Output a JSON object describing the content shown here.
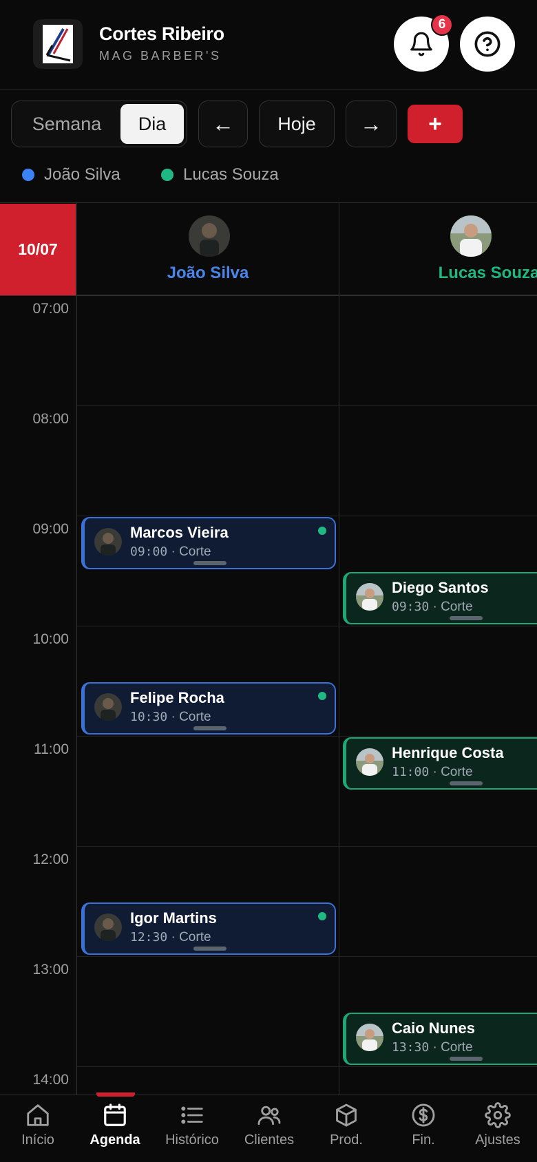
{
  "header": {
    "brand_name": "Cortes Ribeiro",
    "brand_sub": "MAG BARBER'S",
    "notification_count": "6"
  },
  "toolbar": {
    "week_label": "Semana",
    "day_label": "Dia",
    "prev_label": "←",
    "today_label": "Hoje",
    "next_label": "→",
    "add_label": "+"
  },
  "legend": [
    {
      "name": "João Silva",
      "color": "#3b82f6"
    },
    {
      "name": "Lucas Souza",
      "color": "#1fb882"
    }
  ],
  "calendar": {
    "date": "10/07",
    "columns": [
      {
        "name": "João Silva",
        "color": "#4a85ea"
      },
      {
        "name": "Lucas Souza",
        "color": "#1fb882"
      }
    ],
    "times": [
      "07:00",
      "08:00",
      "09:00",
      "10:00",
      "11:00",
      "12:00",
      "13:00",
      "14:00"
    ],
    "appointments": [
      {
        "client": "Marcos Vieira",
        "time": "09:00",
        "service": "· Corte",
        "barber": "João Silva"
      },
      {
        "client": "Diego Santos",
        "time": "09:30",
        "service": "· Corte",
        "barber": "Lucas Souza"
      },
      {
        "client": "Felipe Rocha",
        "time": "10:30",
        "service": "· Corte",
        "barber": "João Silva"
      },
      {
        "client": "Henrique Costa",
        "time": "11:00",
        "service": "· Corte",
        "barber": "Lucas Souza"
      },
      {
        "client": "Igor Martins",
        "time": "12:30",
        "service": "· Corte",
        "barber": "João Silva"
      },
      {
        "client": "Caio Nunes",
        "time": "13:30",
        "service": "· Corte",
        "barber": "Lucas Souza"
      }
    ]
  },
  "nav": [
    {
      "label": "Início",
      "icon": "home-icon",
      "active": false
    },
    {
      "label": "Agenda",
      "icon": "calendar-icon",
      "active": true
    },
    {
      "label": "Histórico",
      "icon": "list-icon",
      "active": false
    },
    {
      "label": "Clientes",
      "icon": "users-icon",
      "active": false
    },
    {
      "label": "Prod.",
      "icon": "box-icon",
      "active": false
    },
    {
      "label": "Fin.",
      "icon": "coin-icon",
      "active": false
    },
    {
      "label": "Ajustes",
      "icon": "gear-icon",
      "active": false
    }
  ]
}
